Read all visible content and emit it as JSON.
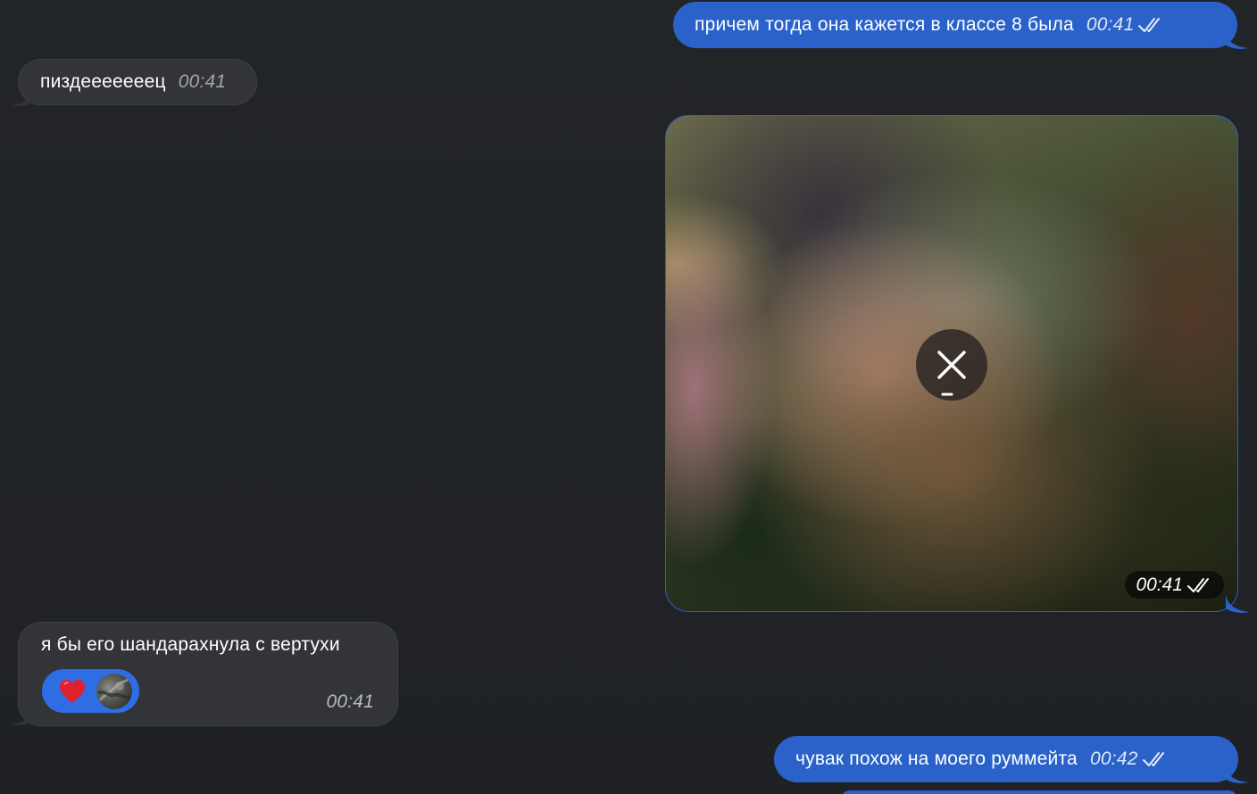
{
  "messages": {
    "m1": {
      "text": "причем тогда она кажется в классе 8 была",
      "time": "00:41"
    },
    "m2": {
      "text": "пиздееееееец",
      "time": "00:41"
    },
    "photo": {
      "time": "00:41"
    },
    "m4": {
      "text": "я бы его шандарахнула с вертухи",
      "time": "00:41",
      "reaction": "heart"
    },
    "m5": {
      "text": "чувак похож на моего руммейта",
      "time": "00:42"
    }
  },
  "colors": {
    "outgoing_bubble": "#2a62c9",
    "incoming_bubble": "#323437",
    "background": "#202225",
    "reaction_pill": "#2f6de4",
    "heart": "#e0202d"
  },
  "icons": {
    "read_receipt": "double-check-icon",
    "cancel_download": "close-icon",
    "reaction": "heart-icon"
  }
}
